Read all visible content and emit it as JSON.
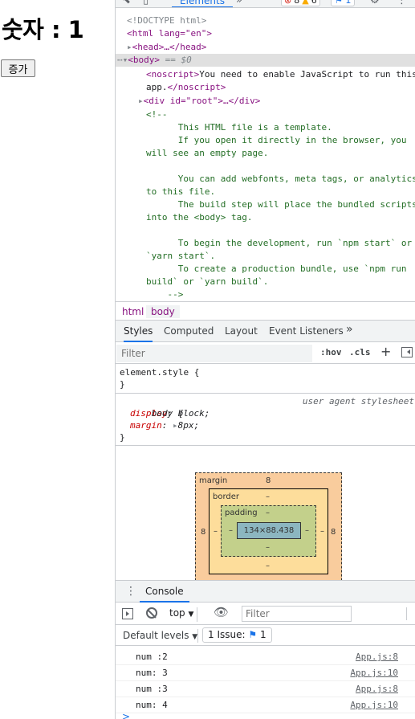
{
  "page": {
    "heading": "숫자 : 1",
    "button_label": "증가"
  },
  "devtools": {
    "toolbar": {
      "elements_tab": "Elements",
      "more": "»",
      "error_count": "8",
      "warning_count": "6",
      "issue_count": "1"
    },
    "dom": {
      "doctype": "<!DOCTYPE html>",
      "html_open": "<html lang=\"en\">",
      "head": "<head>…</head>",
      "body_line": "<body>",
      "body_suffix": " == $0",
      "noscript_open": "<noscript>",
      "noscript_text1": "You need to enable JavaScript to run this",
      "noscript_text2": "app.",
      "noscript_close": "</noscript>",
      "div_root": "<div id=\"root\">…</div>",
      "comment_lines": [
        "<!--",
        "      This HTML file is a template.",
        "      If you open it directly in the browser, you",
        "will see an empty page.",
        "",
        "      You can add webfonts, meta tags, or analytics",
        "to this file.",
        "      The build step will place the bundled scripts",
        "into the <body> tag.",
        "",
        "      To begin the development, run `npm start` or",
        "`yarn start`.",
        "      To create a production bundle, use `npm run",
        "build` or `yarn build`.",
        "    -->"
      ]
    },
    "breadcrumbs": [
      "html",
      "body"
    ],
    "styles_tabs": [
      "Styles",
      "Computed",
      "Layout",
      "Event Listeners",
      "»"
    ],
    "styles_filter_placeholder": "Filter",
    "hov": ":hov",
    "cls": ".cls",
    "rules": {
      "element_style": "element.style {",
      "close": "}",
      "body_selector": "body {",
      "user_agent": "user agent stylesheet",
      "display_name": "display",
      "display_value": "block;",
      "margin_name": "margin",
      "margin_value": "8px;"
    },
    "box_model": {
      "margin_label": "margin",
      "margin_top": "8",
      "margin_left": "8",
      "margin_right": "8",
      "margin_bottom": "–",
      "border_label": "border",
      "border_value": "–",
      "padding_label": "padding",
      "padding_value": "–",
      "content_size": "134×88.438"
    },
    "console": {
      "tab": "Console",
      "context": "top",
      "filter_placeholder": "Filter",
      "levels": "Default levels",
      "issue_btn": "1 Issue:",
      "issue_count": "1",
      "logs": [
        {
          "msg": "num :2",
          "src": "App.js:8"
        },
        {
          "msg": "num: 3",
          "src": "App.js:10"
        },
        {
          "msg": "num :3",
          "src": "App.js:8"
        },
        {
          "msg": "num: 4",
          "src": "App.js:10"
        }
      ],
      "prompt": ">"
    }
  }
}
